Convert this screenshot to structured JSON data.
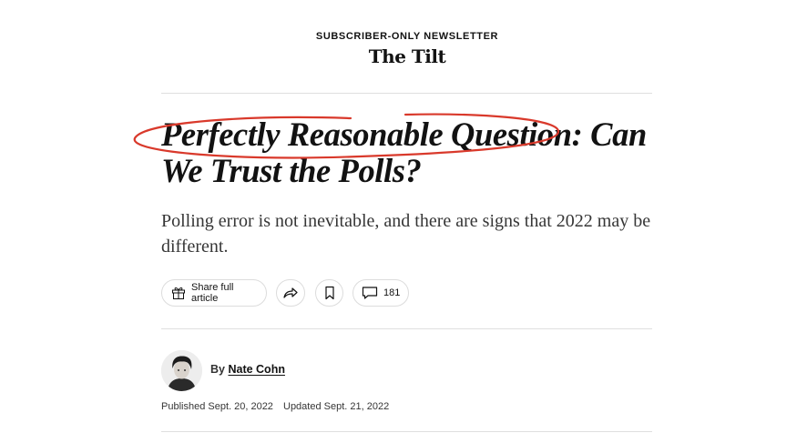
{
  "header": {
    "kicker": "SUBSCRIBER-ONLY NEWSLETTER",
    "series_title": "The Tilt"
  },
  "article": {
    "headline_line1": "Perfectly Reasonable Question: Can",
    "headline_line2": "We Trust the Polls?",
    "summary": "Polling error is not inevitable, and there are signs that 2022 may be different.",
    "annotation_color": "#d9392b"
  },
  "actions": {
    "share_label": "Share full article",
    "share_icon": "gift-icon",
    "forward_icon": "share-arrow-icon",
    "save_icon": "bookmark-icon",
    "comment_icon": "comment-bubble-icon",
    "comment_count": "181"
  },
  "byline": {
    "prefix": "By",
    "author": "Nate Cohn"
  },
  "dates": {
    "published": "Published Sept. 20, 2022",
    "updated": "Updated Sept. 21, 2022"
  }
}
